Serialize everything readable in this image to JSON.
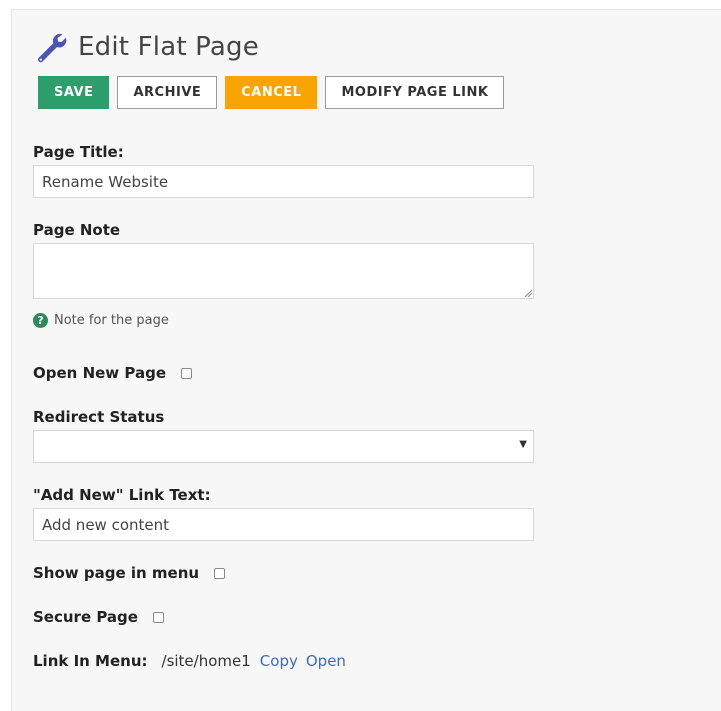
{
  "header": {
    "title": "Edit Flat Page",
    "icon": "wrench-icon"
  },
  "toolbar": {
    "save_label": "SAVE",
    "archive_label": "ARCHIVE",
    "cancel_label": "CANCEL",
    "modify_label": "MODIFY PAGE LINK"
  },
  "form": {
    "page_title_label": "Page Title:",
    "page_title_value": "Rename Website",
    "page_note_label": "Page Note",
    "page_note_value": "",
    "page_note_hint": "Note for the page",
    "open_new_page_label": "Open New Page",
    "redirect_status_label": "Redirect Status",
    "redirect_status_value": "",
    "add_new_label": "\"Add New\" Link Text:",
    "add_new_value": "Add new content",
    "show_in_menu_label": "Show page in menu",
    "secure_page_label": "Secure Page",
    "link_in_menu_label": "Link In Menu:",
    "link_in_menu_path": "/site/home1",
    "copy_label": "Copy",
    "open_label": "Open"
  },
  "colors": {
    "save": "#2d9f6c",
    "cancel": "#f9a400",
    "icon": "#4a55b5",
    "link": "#3c6bbf"
  }
}
